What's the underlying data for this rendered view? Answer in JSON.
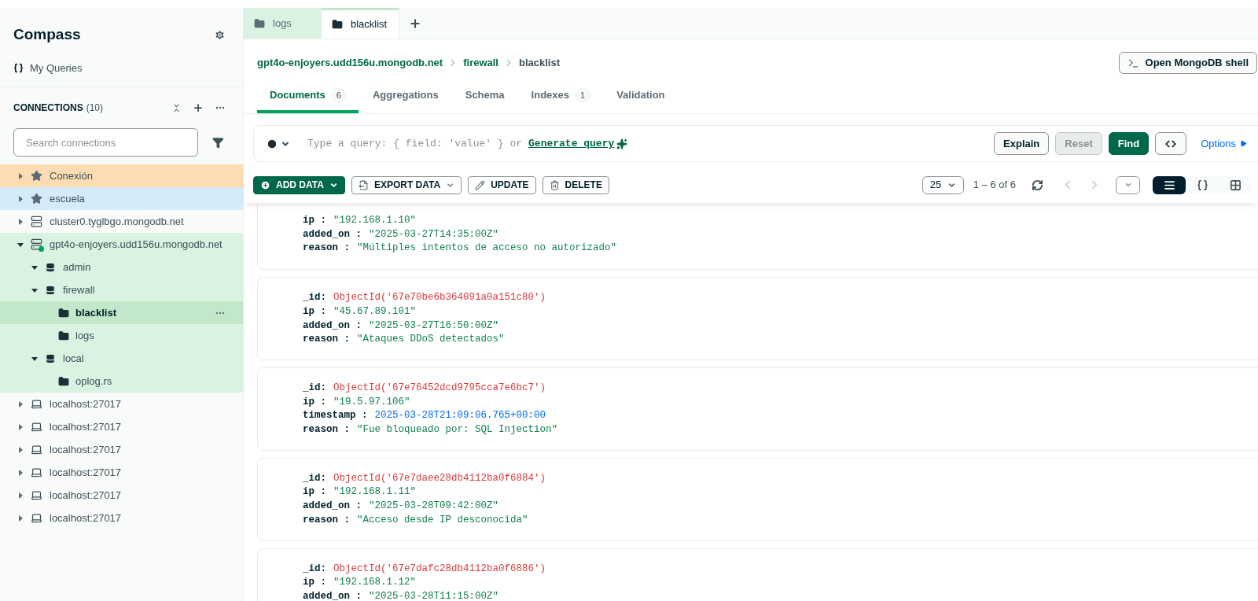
{
  "sidebar": {
    "title": "Compass",
    "my_queries": "My Queries",
    "connections_heading": "CONNECTIONS",
    "connections_count": "(10)",
    "search": {
      "placeholder": "Search connections"
    },
    "connections": [
      {
        "kind": "favorite",
        "name": "Conexión",
        "color": "#fddcb3",
        "expanded": false
      },
      {
        "kind": "favorite",
        "name": "escuela",
        "color": "#d6ebfa",
        "expanded": false
      },
      {
        "kind": "cluster",
        "name": "cluster0.tyglbgo.mongodb.net",
        "expanded": false,
        "connected": false
      },
      {
        "kind": "cluster",
        "name": "gpt4o-enjoyers.udd156u.mongodb.net",
        "expanded": true,
        "connected": true,
        "databases": [
          {
            "name": "admin",
            "expanded": true
          },
          {
            "name": "firewall",
            "expanded": true,
            "collections": [
              {
                "name": "blacklist",
                "selected": true
              },
              {
                "name": "logs",
                "selected": false
              }
            ]
          },
          {
            "name": "local",
            "expanded": true,
            "collections": [
              {
                "name": "oplog.rs",
                "selected": false
              }
            ]
          }
        ]
      },
      {
        "kind": "local",
        "name": "localhost:27017",
        "expanded": false
      },
      {
        "kind": "local",
        "name": "localhost:27017",
        "expanded": false
      },
      {
        "kind": "local",
        "name": "localhost:27017",
        "expanded": false
      },
      {
        "kind": "local",
        "name": "localhost:27017",
        "expanded": false
      },
      {
        "kind": "local",
        "name": "localhost:27017",
        "expanded": false
      },
      {
        "kind": "local",
        "name": "localhost:27017",
        "expanded": false
      }
    ]
  },
  "tabs": [
    {
      "label": "logs",
      "selected": false
    },
    {
      "label": "blacklist",
      "selected": true
    }
  ],
  "breadcrumb": [
    "gpt4o-enjoyers.udd156u.mongodb.net",
    "firewall",
    "blacklist"
  ],
  "shell_button": "Open MongoDB shell",
  "view_tabs": [
    {
      "label": "Documents",
      "count": "6",
      "selected": true
    },
    {
      "label": "Aggregations",
      "selected": false
    },
    {
      "label": "Schema",
      "selected": false
    },
    {
      "label": "Indexes",
      "count": "1",
      "selected": false
    },
    {
      "label": "Validation",
      "selected": false
    }
  ],
  "query": {
    "placeholder": "Type a query: { field: 'value' } or",
    "generate_link": "Generate query",
    "buttons": [
      {
        "label": "Explain",
        "kind": "outline",
        "disabled": false
      },
      {
        "label": "Reset",
        "kind": "outline",
        "disabled": true
      },
      {
        "label": "Find",
        "kind": "primary",
        "disabled": false
      }
    ],
    "options": "Options"
  },
  "toolbar": {
    "buttons": [
      {
        "label": "ADD DATA",
        "kind": "add"
      },
      {
        "label": "EXPORT DATA",
        "kind": "export"
      },
      {
        "label": "UPDATE",
        "kind": "update"
      },
      {
        "label": "DELETE",
        "kind": "delete"
      }
    ],
    "page_size": "25",
    "range": "1 – 6 of 6",
    "views": [
      {
        "kind": "list",
        "selected": true
      },
      {
        "kind": "json",
        "selected": false
      },
      {
        "kind": "table",
        "selected": false
      }
    ]
  },
  "documents": [
    {
      "fields": [
        {
          "key": "ip :",
          "kind": "string",
          "value": "\"192.168.1.10\""
        },
        {
          "key": "added_on :",
          "kind": "string",
          "value": "\"2025-03-27T14:35:00Z\""
        },
        {
          "key": "reason :",
          "kind": "string",
          "value": "\"Múltiples intentos de acceso no autorizado\""
        }
      ]
    },
    {
      "fields": [
        {
          "key": "_id:",
          "kind": "objectid",
          "value": "ObjectId('67e70be6b364091a0a151c80')"
        },
        {
          "key": "ip :",
          "kind": "string",
          "value": "\"45.67.89.101\""
        },
        {
          "key": "added_on :",
          "kind": "string",
          "value": "\"2025-03-27T16:50:00Z\""
        },
        {
          "key": "reason :",
          "kind": "string",
          "value": "\"Ataques DDoS detectados\""
        }
      ]
    },
    {
      "fields": [
        {
          "key": "_id:",
          "kind": "objectid",
          "value": "ObjectId('67e76452dcd9795cca7e6bc7')"
        },
        {
          "key": "ip :",
          "kind": "string",
          "value": "\"19.5.97.106\""
        },
        {
          "key": "timestamp :",
          "kind": "date",
          "value": "2025-03-28T21:09:06.765+00:00"
        },
        {
          "key": "reason :",
          "kind": "string",
          "value": "\"Fue bloqueado por: SQL Injection\""
        }
      ]
    },
    {
      "fields": [
        {
          "key": "_id:",
          "kind": "objectid",
          "value": "ObjectId('67e7daee28db4112ba0f6884')"
        },
        {
          "key": "ip :",
          "kind": "string",
          "value": "\"192.168.1.11\""
        },
        {
          "key": "added_on :",
          "kind": "string",
          "value": "\"2025-03-28T09:42:00Z\""
        },
        {
          "key": "reason :",
          "kind": "string",
          "value": "\"Acceso desde IP desconocida\""
        }
      ]
    },
    {
      "fields": [
        {
          "key": "_id:",
          "kind": "objectid",
          "value": "ObjectId('67e7dafc28db4112ba0f6886')"
        },
        {
          "key": "ip :",
          "kind": "string",
          "value": "\"192.168.1.12\""
        },
        {
          "key": "added_on :",
          "kind": "string",
          "value": "\"2025-03-28T11:15:00Z\""
        }
      ]
    }
  ]
}
